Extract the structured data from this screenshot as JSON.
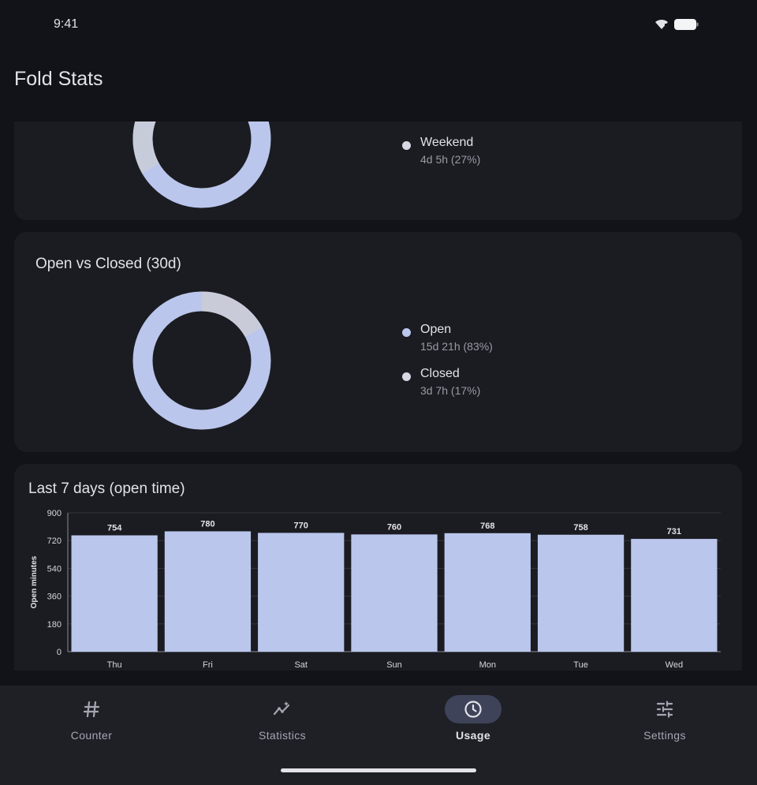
{
  "status_bar": {
    "time": "9:41"
  },
  "app_bar": {
    "title": "Fold Stats"
  },
  "weekday_card": {
    "legend": [
      {
        "label": "Weekend",
        "value": "4d 5h (27%)"
      }
    ]
  },
  "open_closed_card": {
    "title": "Open vs Closed (30d)",
    "legend": [
      {
        "label": "Open",
        "value": "15d 21h (83%)"
      },
      {
        "label": "Closed",
        "value": "3d 7h (17%)"
      }
    ],
    "percent_open": 83
  },
  "chart_data": {
    "type": "bar",
    "title": "Last 7 days (open time)",
    "xlabel": "",
    "ylabel": "Open minutes",
    "categories": [
      "Thu",
      "Fri",
      "Sat",
      "Sun",
      "Mon",
      "Tue",
      "Wed"
    ],
    "values": [
      754,
      780,
      770,
      760,
      768,
      758,
      731
    ],
    "ylim": [
      0,
      900
    ],
    "yticks": [
      0,
      180,
      360,
      540,
      720,
      900
    ],
    "bar_color": "#bac6ec",
    "grid": true
  },
  "bottom_nav": {
    "items": [
      {
        "label": "Counter",
        "icon": "hash-icon",
        "active": false
      },
      {
        "label": "Statistics",
        "icon": "statistics-icon",
        "active": false
      },
      {
        "label": "Usage",
        "icon": "clock-icon",
        "active": true
      },
      {
        "label": "Settings",
        "icon": "sliders-icon",
        "active": false
      }
    ]
  },
  "colors": {
    "background": "#121318",
    "card": "#1b1c21",
    "accent": "#bac6ec",
    "nav_active_pill": "#3e4359"
  }
}
